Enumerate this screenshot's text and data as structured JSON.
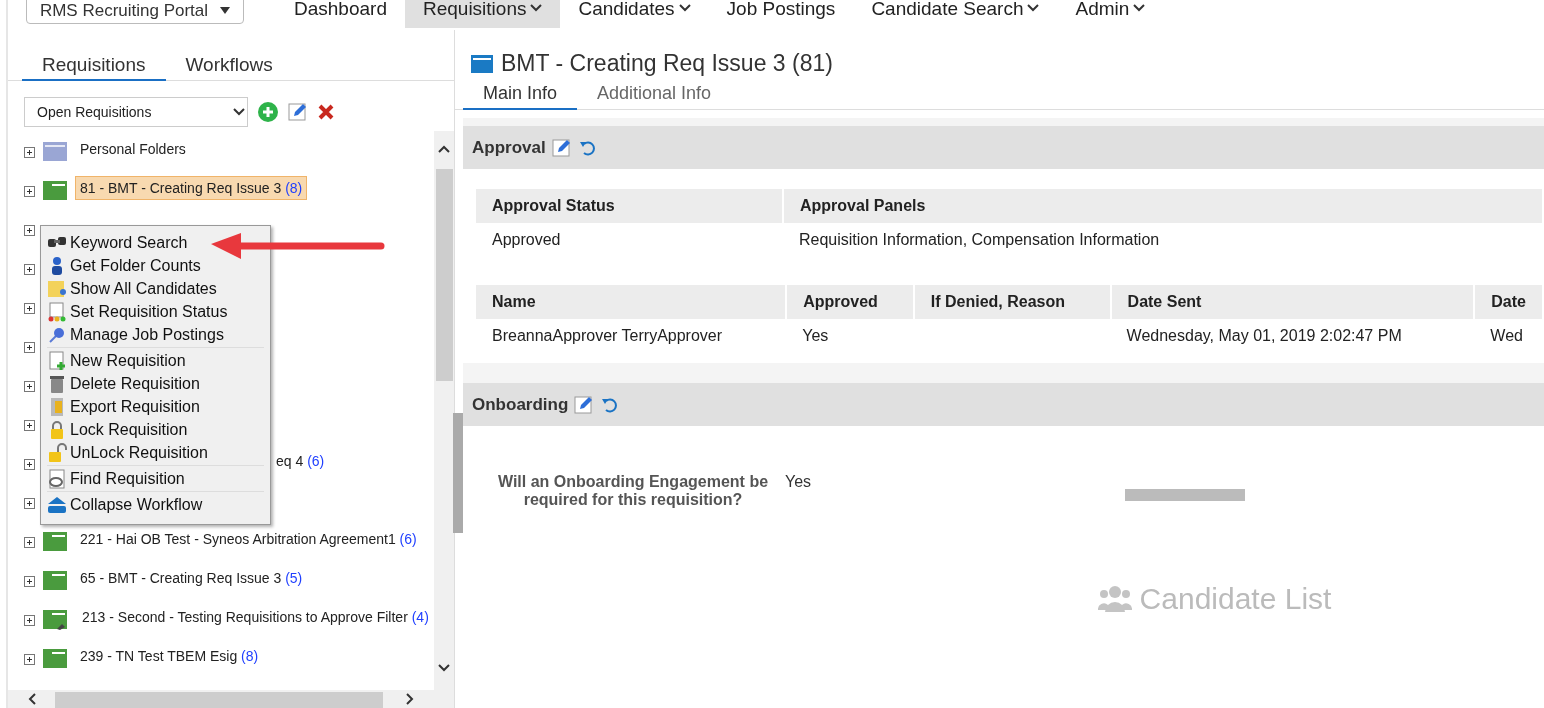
{
  "portal_selector": {
    "label": "RMS Recruiting Portal"
  },
  "nav": [
    {
      "label": "Dashboard",
      "has_menu": false,
      "selected": false
    },
    {
      "label": "Requisitions",
      "has_menu": true,
      "selected": true
    },
    {
      "label": "Candidates",
      "has_menu": true,
      "selected": false
    },
    {
      "label": "Job Postings",
      "has_menu": false,
      "selected": false
    },
    {
      "label": "Candidate Search",
      "has_menu": true,
      "selected": false
    },
    {
      "label": "Admin",
      "has_menu": true,
      "selected": false
    }
  ],
  "side_tabs": [
    {
      "label": "Requisitions",
      "selected": true
    },
    {
      "label": "Workflows",
      "selected": false
    }
  ],
  "filter": {
    "value": "Open Requisitions"
  },
  "tree": [
    {
      "kind": "personal",
      "label": "Personal Folders",
      "selected": false
    },
    {
      "kind": "folder",
      "label": "81 - BMT - Creating Req Issue 3",
      "count": "(8)",
      "selected": true
    },
    {
      "kind": "hidden"
    },
    {
      "kind": "hidden"
    },
    {
      "kind": "hidden"
    },
    {
      "kind": "hidden"
    },
    {
      "kind": "hidden"
    },
    {
      "kind": "hidden"
    },
    {
      "kind": "partial",
      "label": "eq 4",
      "count": "(6)",
      "selected": false
    },
    {
      "kind": "hidden"
    },
    {
      "kind": "folder",
      "label": "221 - Hai OB Test - Syneos Arbitration Agreement1",
      "count": "(6)",
      "selected": false
    },
    {
      "kind": "folder",
      "label": "65 - BMT - Creating Req Issue 3",
      "count": "(5)",
      "selected": false
    },
    {
      "kind": "pinned",
      "label": "213 - Second - Testing Requisitions to Approve Filter",
      "count": "(4)",
      "selected": false
    },
    {
      "kind": "folder",
      "label": "239 - TN Test TBEM Esig",
      "count": "(8)",
      "selected": false
    }
  ],
  "context_menu": [
    {
      "items": [
        {
          "kind": "binoculars",
          "label": "Keyword Search"
        },
        {
          "kind": "person",
          "label": "Get Folder Counts"
        },
        {
          "kind": "folder-person",
          "label": "Show All Candidates"
        },
        {
          "kind": "status",
          "label": "Set Requisition Status"
        },
        {
          "kind": "pin",
          "label": "Manage Job Postings"
        }
      ]
    },
    {
      "items": [
        {
          "kind": "new",
          "label": "New Requisition"
        },
        {
          "kind": "trash",
          "label": "Delete Requisition"
        },
        {
          "kind": "export",
          "label": "Export Requisition"
        },
        {
          "kind": "lock",
          "label": "Lock Requisition"
        },
        {
          "kind": "unlock",
          "label": "UnLock Requisition"
        }
      ]
    },
    {
      "items": [
        {
          "kind": "find",
          "label": "Find Requisition"
        }
      ]
    },
    {
      "items": [
        {
          "kind": "collapse",
          "label": "Collapse Workflow"
        }
      ]
    }
  ],
  "detail": {
    "title": "BMT - Creating Req Issue 3 (81)",
    "tabs": [
      {
        "label": "Main Info",
        "selected": true
      },
      {
        "label": "Additional Info",
        "selected": false
      }
    ],
    "approval": {
      "title": "Approval",
      "summary": {
        "columns": [
          "Approval Status",
          "Approval Panels"
        ],
        "rows": [
          [
            "Approved",
            "Requisition Information, Compensation Information"
          ]
        ]
      },
      "approvers": {
        "columns": [
          "Name",
          "Approved",
          "If Denied, Reason",
          "Date Sent",
          "Date"
        ],
        "rows": [
          [
            "BreannaApprover TerryApprover",
            "Yes",
            "",
            "Wednesday, May 01, 2019 2:02:47 PM",
            "Wed"
          ]
        ]
      }
    },
    "onboarding": {
      "title": "Onboarding",
      "question": "Will an Onboarding Engagement be required for this requisition?",
      "answer": "Yes"
    }
  },
  "candidate_list": {
    "label": "Candidate List"
  }
}
